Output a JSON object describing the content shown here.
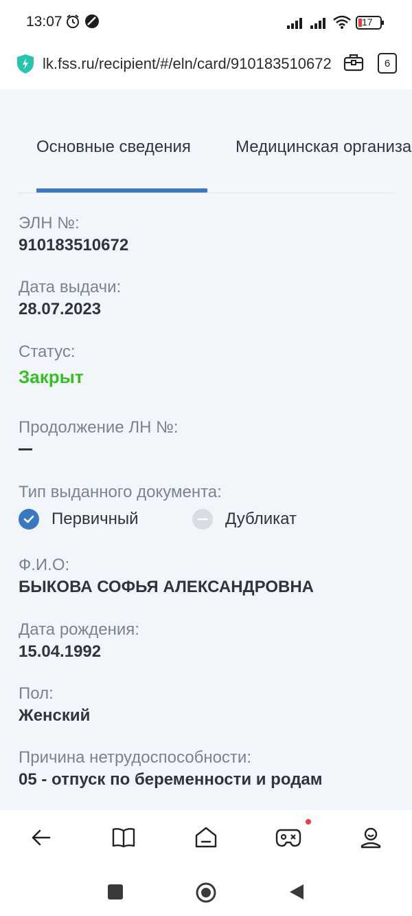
{
  "status_bar": {
    "time": "13:07",
    "battery": "17"
  },
  "browser": {
    "url": "lk.fss.ru/recipient/#/eln/card/910183510672",
    "tab_count": "6"
  },
  "tabs": [
    {
      "label": "Основные сведения",
      "active": true
    },
    {
      "label": "Медицинская организация",
      "active": false
    }
  ],
  "fields": {
    "eln_label": "ЭЛН №:",
    "eln_value": "910183510672",
    "issue_date_label": "Дата выдачи:",
    "issue_date_value": "28.07.2023",
    "status_label": "Статус:",
    "status_value": "Закрыт",
    "continuation_label": "Продолжение ЛН №:",
    "doc_type_label": "Тип выданного документа:",
    "doc_type_primary": "Первичный",
    "doc_type_duplicate": "Дубликат",
    "fio_label": "Ф.И.О:",
    "fio_value": "БЫКОВА СОФЬЯ АЛЕКСАНДРОВНА",
    "birth_label": "Дата рождения:",
    "birth_value": "15.04.1992",
    "sex_label": "Пол:",
    "sex_value": "Женский",
    "reason_label": "Причина нетрудоспособности:",
    "reason_value": "05 - отпуск по беременности и родам"
  },
  "colors": {
    "accent": "#3a78c0",
    "status_closed": "#33c11f",
    "badge": "#ee3b3b"
  },
  "icons": {
    "bottom_nav": [
      "back-arrow-icon",
      "book-icon",
      "home-icon",
      "gamepad-icon",
      "profile-icon"
    ],
    "system_nav": [
      "recents-square-icon",
      "home-circle-icon",
      "back-triangle-icon"
    ]
  }
}
